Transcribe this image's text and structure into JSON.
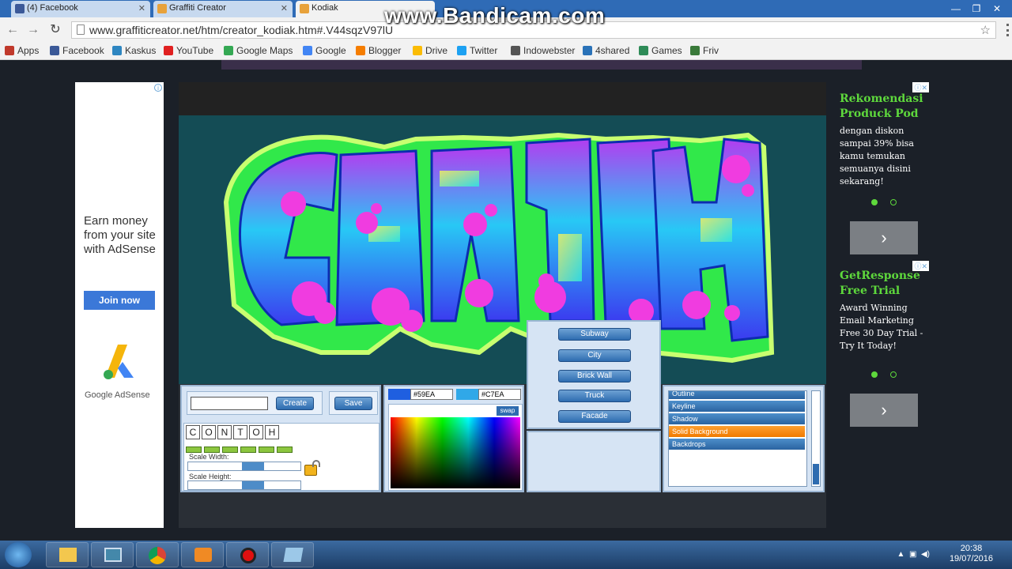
{
  "browser": {
    "tabs": [
      {
        "label": "(4) Facebook",
        "color": "#3b5998"
      },
      {
        "label": "Graffiti Creator",
        "color": "#e8a23b"
      },
      {
        "label": "Kodiak",
        "color": "#e8a23b"
      }
    ],
    "url": "www.graffiticreator.net/htm/creator_kodiak.htm#.V44sqzV97lU",
    "bookmarks": [
      {
        "label": "Apps",
        "color": "#c0392b"
      },
      {
        "label": "Facebook",
        "color": "#3b5998"
      },
      {
        "label": "Kaskus",
        "color": "#2e86c1"
      },
      {
        "label": "YouTube",
        "color": "#e02020"
      },
      {
        "label": "Google Maps",
        "color": "#34a853"
      },
      {
        "label": "Google",
        "color": "#4285f4"
      },
      {
        "label": "Blogger",
        "color": "#f57d00"
      },
      {
        "label": "Drive",
        "color": "#fbbc05"
      },
      {
        "label": "Twitter",
        "color": "#1da1f2"
      },
      {
        "label": "Indowebster",
        "color": "#555555"
      },
      {
        "label": "4shared",
        "color": "#2a72b8"
      },
      {
        "label": "Games",
        "color": "#2e8b57"
      },
      {
        "label": "Friv",
        "color": "#3a7a3a"
      }
    ]
  },
  "watermark": "www.Bandicam.com",
  "left_ad": {
    "headline": "Earn money from your site with AdSense",
    "button": "Join now",
    "brand": "Google AdSense"
  },
  "creator": {
    "text_input": "",
    "create_label": "Create",
    "save_label": "Save",
    "letters": [
      "C",
      "O",
      "N",
      "T",
      "O",
      "H"
    ],
    "scale_width_label": "Scale Width:",
    "scale_height_label": "Scale Height:",
    "scale_width_value": 0.6,
    "scale_height_value": 0.6,
    "color1": "#59EA",
    "color2": "#C7EA",
    "swap_label": "swap",
    "backgrounds": [
      "Subway",
      "City",
      "Brick Wall",
      "Truck",
      "Facade"
    ],
    "layers": [
      "Outline",
      "Keyline",
      "Shadow",
      "Solid Background",
      "Backdrops"
    ],
    "selected_layer": "Solid Background"
  },
  "right_ads": [
    {
      "title": "Rekomendasi Produck Pod",
      "body": "dengan diskon sampai 39% bisa kamu temukan semuanya disini sekarang!"
    },
    {
      "title": "GetResponse Free Trial",
      "body": "Award Winning Email Marketing Free 30 Day Trial - Try It Today!"
    }
  ],
  "taskbar": {
    "time": "20:38",
    "date": "19/07/2016"
  }
}
